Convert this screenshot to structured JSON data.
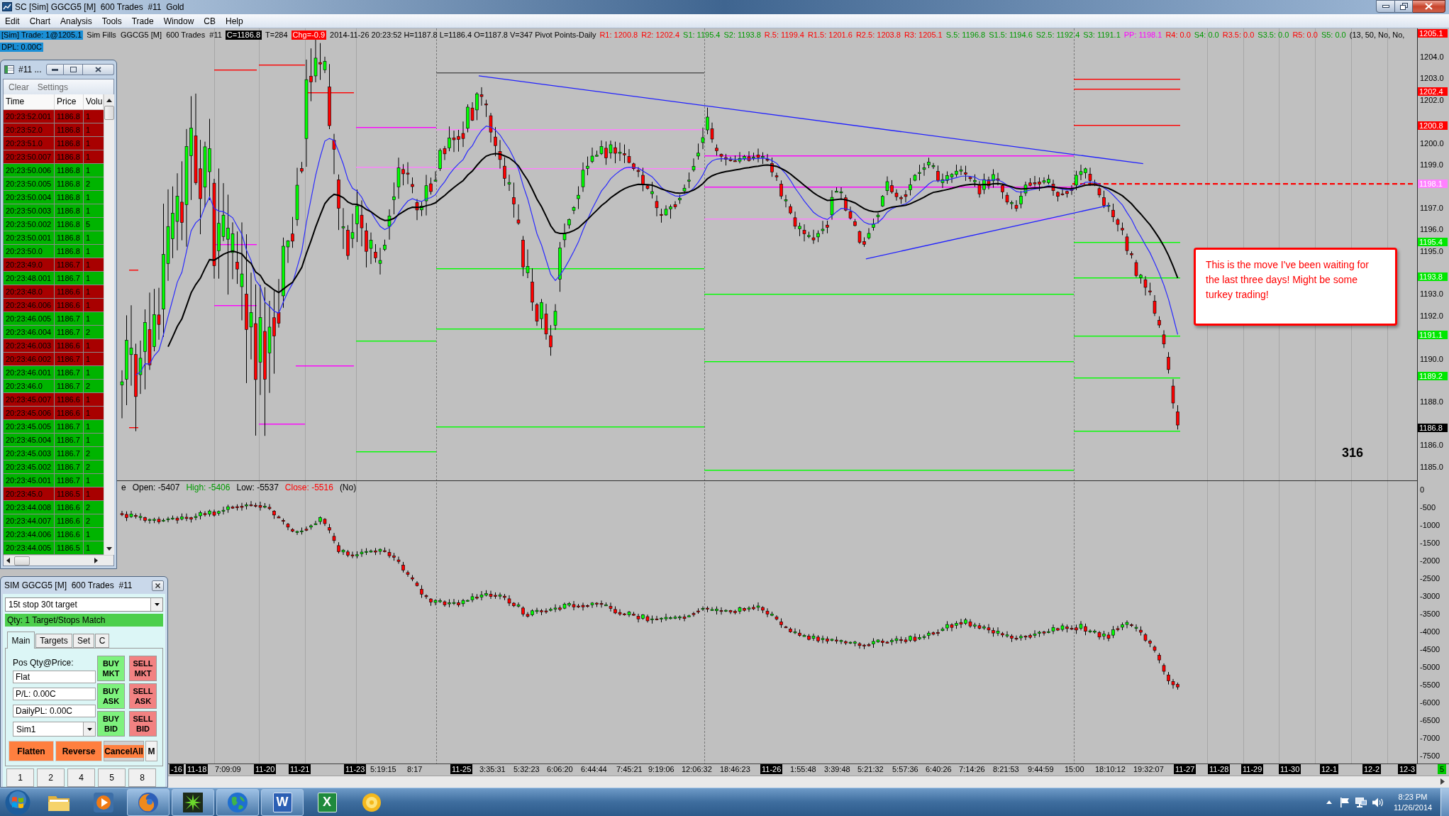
{
  "window": {
    "title": "SC [Sim] GGCG5 [M]  600 Trades  #11  Gold"
  },
  "menu": [
    "Edit",
    "Chart",
    "Analysis",
    "Tools",
    "Trade",
    "Window",
    "CB",
    "Help"
  ],
  "chart": {
    "header": {
      "sim_trade": "[Sim] Trade: 1@1205.1",
      "info": "Sim Fills  GGCG5 [M]  600 Trades  #11",
      "close": "C=1186.8",
      "trades": "T=284",
      "change": "Chg=-0.9",
      "bar_info": "2014-11-26 20:23:52 H=1187.8 L=1186.4 O=1187.8 V=347 Pivot Points-Daily",
      "pivots": [
        {
          "text": "R1: 1200.8",
          "color": "#ff0000"
        },
        {
          "text": "R2: 1202.4",
          "color": "#ff0000"
        },
        {
          "text": "S1: 1195.4",
          "color": "#009a00"
        },
        {
          "text": "S2: 1193.8",
          "color": "#009a00"
        },
        {
          "text": "R.5: 1199.4",
          "color": "#ff0000"
        },
        {
          "text": "R1.5: 1201.6",
          "color": "#ff0000"
        },
        {
          "text": "R2.5: 1203.8",
          "color": "#ff0000"
        },
        {
          "text": "R3: 1205.1",
          "color": "#ff0000"
        },
        {
          "text": "S.5: 1196.8",
          "color": "#009a00"
        },
        {
          "text": "S1.5: 1194.6",
          "color": "#009a00"
        },
        {
          "text": "S2.5: 1192.4",
          "color": "#009a00"
        },
        {
          "text": "S3: 1191.1",
          "color": "#009a00"
        },
        {
          "text": "PP: 1198.1",
          "color": "#ff00ff"
        },
        {
          "text": "R4: 0.0",
          "color": "#ff0000"
        },
        {
          "text": "S4: 0.0",
          "color": "#009a00"
        },
        {
          "text": "R3.5: 0.0",
          "color": "#ff0000"
        },
        {
          "text": "S3.5: 0.0",
          "color": "#009a00"
        },
        {
          "text": "R5: 0.0",
          "color": "#ff0000"
        },
        {
          "text": "S5: 0.0",
          "color": "#009a00"
        }
      ],
      "study_params": "(13, 50, No, No,",
      "daily_pl": "DPL: 0.00C"
    },
    "lower_pane_header": [
      {
        "text": "e",
        "color": "#000000"
      },
      {
        "text": "Open: -5407",
        "color": "#000000"
      },
      {
        "text": "High: -5406",
        "color": "#009a00"
      },
      {
        "text": "Low: -5537",
        "color": "#000000"
      },
      {
        "text": "Close: -5516",
        "color": "#ff0000"
      },
      {
        "text": "(No)",
        "color": "#000000"
      }
    ],
    "callout": "This is the move I've been waiting for the last three days! Might be some turkey trading!",
    "overlay_number": "316",
    "price_axis": {
      "labels": [
        "1204.0",
        "1203.0",
        "1202.0",
        "1200.0",
        "1199.0",
        "1197.0",
        "1196.0",
        "1195.0",
        "1193.0",
        "1192.0",
        "1190.0",
        "1188.0",
        "1186.0",
        "1185.0"
      ],
      "markers": [
        {
          "text": "1205.1",
          "color": "#ff0000"
        },
        {
          "text": "1202.4",
          "color": "#ff0000"
        },
        {
          "text": "1200.8",
          "color": "#ff0000"
        },
        {
          "text": "1198.1",
          "color": "#ff80ff"
        },
        {
          "text": "1195.4",
          "color": "#00e800"
        },
        {
          "text": "1193.8",
          "color": "#00e800"
        },
        {
          "text": "1191.1",
          "color": "#00e800"
        },
        {
          "text": "1189.2",
          "color": "#00e800"
        },
        {
          "text": "1186.8",
          "color": "#000000"
        }
      ]
    },
    "delta_axis": {
      "labels": [
        "0",
        "-500",
        "-1000",
        "-1500",
        "-2000",
        "-2500",
        "-3000",
        "-3500",
        "-4000",
        "-4500",
        "-5000",
        "-5500",
        "-6000",
        "-6500",
        "-7000",
        "-7500"
      ]
    },
    "time_axis": {
      "labels": [
        {
          "text": "-16",
          "kind": "date"
        },
        {
          "text": "11-18",
          "kind": "date"
        },
        {
          "text": "7:09:09",
          "kind": "time"
        },
        {
          "text": "11-20",
          "kind": "date"
        },
        {
          "text": "11-21",
          "kind": "date"
        },
        {
          "text": "11-23",
          "kind": "date"
        },
        {
          "text": "5:19:15",
          "kind": "time"
        },
        {
          "text": "8:17",
          "kind": "time"
        },
        {
          "text": "11-25",
          "kind": "date"
        },
        {
          "text": "3:35:31",
          "kind": "time"
        },
        {
          "text": "5:32:23",
          "kind": "time"
        },
        {
          "text": "6:06:20",
          "kind": "time"
        },
        {
          "text": "6:44:44",
          "kind": "time"
        },
        {
          "text": "7:45:21",
          "kind": "time"
        },
        {
          "text": "9:19:06",
          "kind": "time"
        },
        {
          "text": "12:06:32",
          "kind": "time"
        },
        {
          "text": "18:46:23",
          "kind": "time"
        },
        {
          "text": "11-26",
          "kind": "date"
        },
        {
          "text": "1:55:48",
          "kind": "time"
        },
        {
          "text": "3:39:48",
          "kind": "time"
        },
        {
          "text": "5:21:32",
          "kind": "time"
        },
        {
          "text": "5:57:36",
          "kind": "time"
        },
        {
          "text": "6:40:26",
          "kind": "time"
        },
        {
          "text": "7:14:26",
          "kind": "time"
        },
        {
          "text": "8:21:53",
          "kind": "time"
        },
        {
          "text": "9:44:59",
          "kind": "time"
        },
        {
          "text": "15:00",
          "kind": "time"
        },
        {
          "text": "18:10:12",
          "kind": "time"
        },
        {
          "text": "19:32:07",
          "kind": "time"
        },
        {
          "text": "11-27",
          "kind": "date"
        },
        {
          "text": "11-28",
          "kind": "date"
        },
        {
          "text": "11-29",
          "kind": "date"
        },
        {
          "text": "11-30",
          "kind": "date"
        },
        {
          "text": "12-1",
          "kind": "date"
        },
        {
          "text": "12-2",
          "kind": "date"
        },
        {
          "text": "12-3",
          "kind": "date"
        },
        {
          "text": "5",
          "kind": "count"
        }
      ]
    }
  },
  "time_and_sales": {
    "title": "#11 ...",
    "menu": [
      "Clear",
      "Settings"
    ],
    "columns": [
      "Time",
      "Price",
      "Volu"
    ],
    "rows": [
      {
        "time": "20:23:52.001",
        "price": "1186.8",
        "volume": "1",
        "color": "#a80000"
      },
      {
        "time": "20:23:52.0",
        "price": "1186.8",
        "volume": "1",
        "color": "#a80000"
      },
      {
        "time": "20:23:51.0",
        "price": "1186.8",
        "volume": "1",
        "color": "#a80000"
      },
      {
        "time": "20:23:50.007",
        "price": "1186.8",
        "volume": "1",
        "color": "#a80000"
      },
      {
        "time": "20:23:50.006",
        "price": "1186.8",
        "volume": "1",
        "color": "#00b400"
      },
      {
        "time": "20:23:50.005",
        "price": "1186.8",
        "volume": "2",
        "color": "#00b400"
      },
      {
        "time": "20:23:50.004",
        "price": "1186.8",
        "volume": "1",
        "color": "#00b400"
      },
      {
        "time": "20:23:50.003",
        "price": "1186.8",
        "volume": "1",
        "color": "#00b400"
      },
      {
        "time": "20:23:50.002",
        "price": "1186.8",
        "volume": "5",
        "color": "#00b400"
      },
      {
        "time": "20:23:50.001",
        "price": "1186.8",
        "volume": "1",
        "color": "#00b400"
      },
      {
        "time": "20:23:50.0",
        "price": "1186.8",
        "volume": "1",
        "color": "#00b400"
      },
      {
        "time": "20:23:49.0",
        "price": "1186.7",
        "volume": "1",
        "color": "#a80000"
      },
      {
        "time": "20:23:48.001",
        "price": "1186.7",
        "volume": "1",
        "color": "#00b400"
      },
      {
        "time": "20:23:48.0",
        "price": "1186.6",
        "volume": "1",
        "color": "#a80000"
      },
      {
        "time": "20:23:46.006",
        "price": "1186.6",
        "volume": "1",
        "color": "#a80000"
      },
      {
        "time": "20:23:46.005",
        "price": "1186.7",
        "volume": "1",
        "color": "#00b400"
      },
      {
        "time": "20:23:46.004",
        "price": "1186.7",
        "volume": "2",
        "color": "#00b400"
      },
      {
        "time": "20:23:46.003",
        "price": "1186.6",
        "volume": "1",
        "color": "#a80000"
      },
      {
        "time": "20:23:46.002",
        "price": "1186.7",
        "volume": "1",
        "color": "#a80000"
      },
      {
        "time": "20:23:46.001",
        "price": "1186.7",
        "volume": "1",
        "color": "#00b400"
      },
      {
        "time": "20:23:46.0",
        "price": "1186.7",
        "volume": "2",
        "color": "#00b400"
      },
      {
        "time": "20:23:45.007",
        "price": "1186.6",
        "volume": "1",
        "color": "#a80000"
      },
      {
        "time": "20:23:45.006",
        "price": "1186.6",
        "volume": "1",
        "color": "#a80000"
      },
      {
        "time": "20:23:45.005",
        "price": "1186.7",
        "volume": "1",
        "color": "#00b400"
      },
      {
        "time": "20:23:45.004",
        "price": "1186.7",
        "volume": "1",
        "color": "#00b400"
      },
      {
        "time": "20:23:45.003",
        "price": "1186.7",
        "volume": "2",
        "color": "#00b400"
      },
      {
        "time": "20:23:45.002",
        "price": "1186.7",
        "volume": "2",
        "color": "#00b400"
      },
      {
        "time": "20:23:45.001",
        "price": "1186.7",
        "volume": "1",
        "color": "#00b400"
      },
      {
        "time": "20:23:45.0",
        "price": "1186.5",
        "volume": "1",
        "color": "#a80000"
      },
      {
        "time": "20:23:44.008",
        "price": "1186.6",
        "volume": "2",
        "color": "#00b400"
      },
      {
        "time": "20:23:44.007",
        "price": "1186.6",
        "volume": "2",
        "color": "#00b400"
      },
      {
        "time": "20:23:44.006",
        "price": "1186.6",
        "volume": "1",
        "color": "#00b400"
      },
      {
        "time": "20:23:44.005",
        "price": "1186.5",
        "volume": "1",
        "color": "#00b400"
      }
    ]
  },
  "trade_window": {
    "title": "SIM GGCG5 [M]  600 Trades  #11",
    "strategy": "15t stop 30t target",
    "status": "Qty: 1 Target/Stops Match",
    "tabs": [
      {
        "label": "Main",
        "selected": true
      },
      {
        "label": "Targets",
        "selected": false
      },
      {
        "label": "Set",
        "selected": false
      },
      {
        "label": "C",
        "selected": false
      }
    ],
    "position_label": "Pos Qty@Price:",
    "position": "Flat",
    "pl": "P/L: 0.00C",
    "daily_pl": "DailyPL: 0.00C",
    "account": "Sim1",
    "order_buttons": [
      {
        "label": "BUY MKT",
        "kind": "buy"
      },
      {
        "label": "SELL MKT",
        "kind": "sell"
      },
      {
        "label": "BUY ASK",
        "kind": "buy"
      },
      {
        "label": "SELL ASK",
        "kind": "sell"
      },
      {
        "label": "BUY BID",
        "kind": "buy"
      },
      {
        "label": "SELL BID",
        "kind": "sell"
      }
    ],
    "actions": [
      {
        "label": "Flatten",
        "kind": "action"
      },
      {
        "label": "Reverse",
        "kind": "action"
      },
      {
        "label": "CancelAll",
        "kind": "cancel"
      },
      {
        "label": "M",
        "kind": "plain"
      }
    ],
    "quantities": [
      "1",
      "2",
      "4",
      "5",
      "8"
    ]
  },
  "taskbar": {
    "apps": [
      {
        "kind": "folder",
        "running": false
      },
      {
        "kind": "media",
        "running": false
      },
      {
        "kind": "browser",
        "running": true
      },
      {
        "kind": "star",
        "running": true
      },
      {
        "kind": "globe",
        "running": true
      },
      {
        "kind": "doc",
        "label": "W",
        "running": true
      },
      {
        "kind": "sheet",
        "label": "X",
        "running": false
      },
      {
        "kind": "disc",
        "running": false
      }
    ],
    "clock": {
      "time": "8:23 PM",
      "date": "11/26/2014"
    }
  }
}
